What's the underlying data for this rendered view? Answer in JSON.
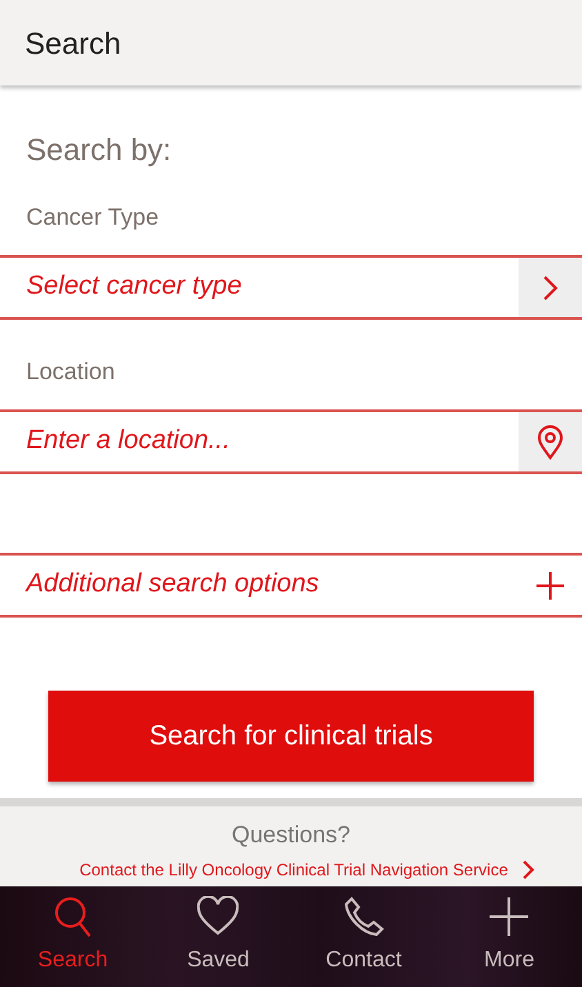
{
  "header": {
    "title": "Search"
  },
  "form": {
    "heading": "Search by:",
    "fields": [
      {
        "label": "Cancer Type",
        "kind": "select",
        "value": "Select cancer type"
      },
      {
        "label": "Location",
        "kind": "location",
        "placeholder": "Enter a location..."
      },
      {
        "kind": "expander",
        "value": "Additional search options",
        "expanded": false
      }
    ],
    "submit": "Search for clinical trials"
  },
  "questions": {
    "title": "Questions?",
    "link": "Contact the Lilly Oncology Clinical Trial Navigation Service"
  },
  "nav": [
    {
      "label": "Search",
      "kind": "search",
      "selected": true
    },
    {
      "label": "Saved",
      "kind": "saved",
      "selected": false
    },
    {
      "label": "Contact",
      "kind": "contact",
      "selected": false
    },
    {
      "label": "More",
      "kind": "more",
      "selected": false
    }
  ]
}
